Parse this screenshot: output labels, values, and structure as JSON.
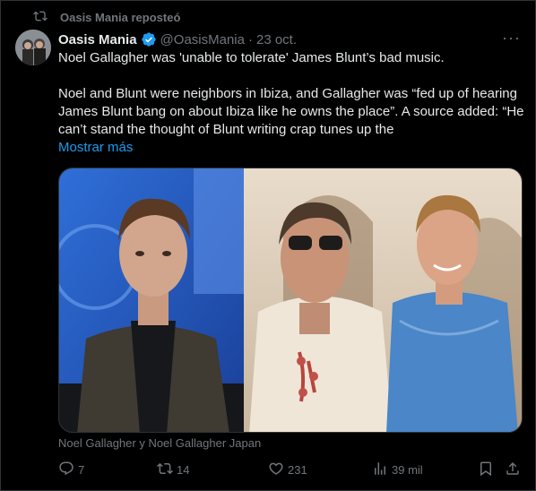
{
  "repost": {
    "text": "Oasis Mania reposteó",
    "icon": "repost-icon"
  },
  "author": {
    "name": "Oasis Mania",
    "handle": "@OasisMania",
    "dot": "·",
    "date": "23 oct.",
    "verified": true
  },
  "tweet": {
    "paragraph1": "Noel Gallagher was 'unable to tolerate' James Blunt’s bad music.",
    "paragraph2": "Noel and Blunt were neighbors in Ibiza, and Gallagher was “fed up of hearing James Blunt bang on about Ibiza like he owns the place”. A source added: “He can’t stand the thought of Blunt writing crap tunes up the",
    "show_more": "Mostrar más"
  },
  "media": {
    "caption": "Noel Gallagher y Noel Gallagher Japan"
  },
  "actions": {
    "replies": "7",
    "reposts": "14",
    "likes": "231",
    "views": "39 mil"
  },
  "colors": {
    "accent": "#1d9bf0",
    "muted": "#71767b",
    "text": "#e7e9ea",
    "background": "#000000"
  }
}
